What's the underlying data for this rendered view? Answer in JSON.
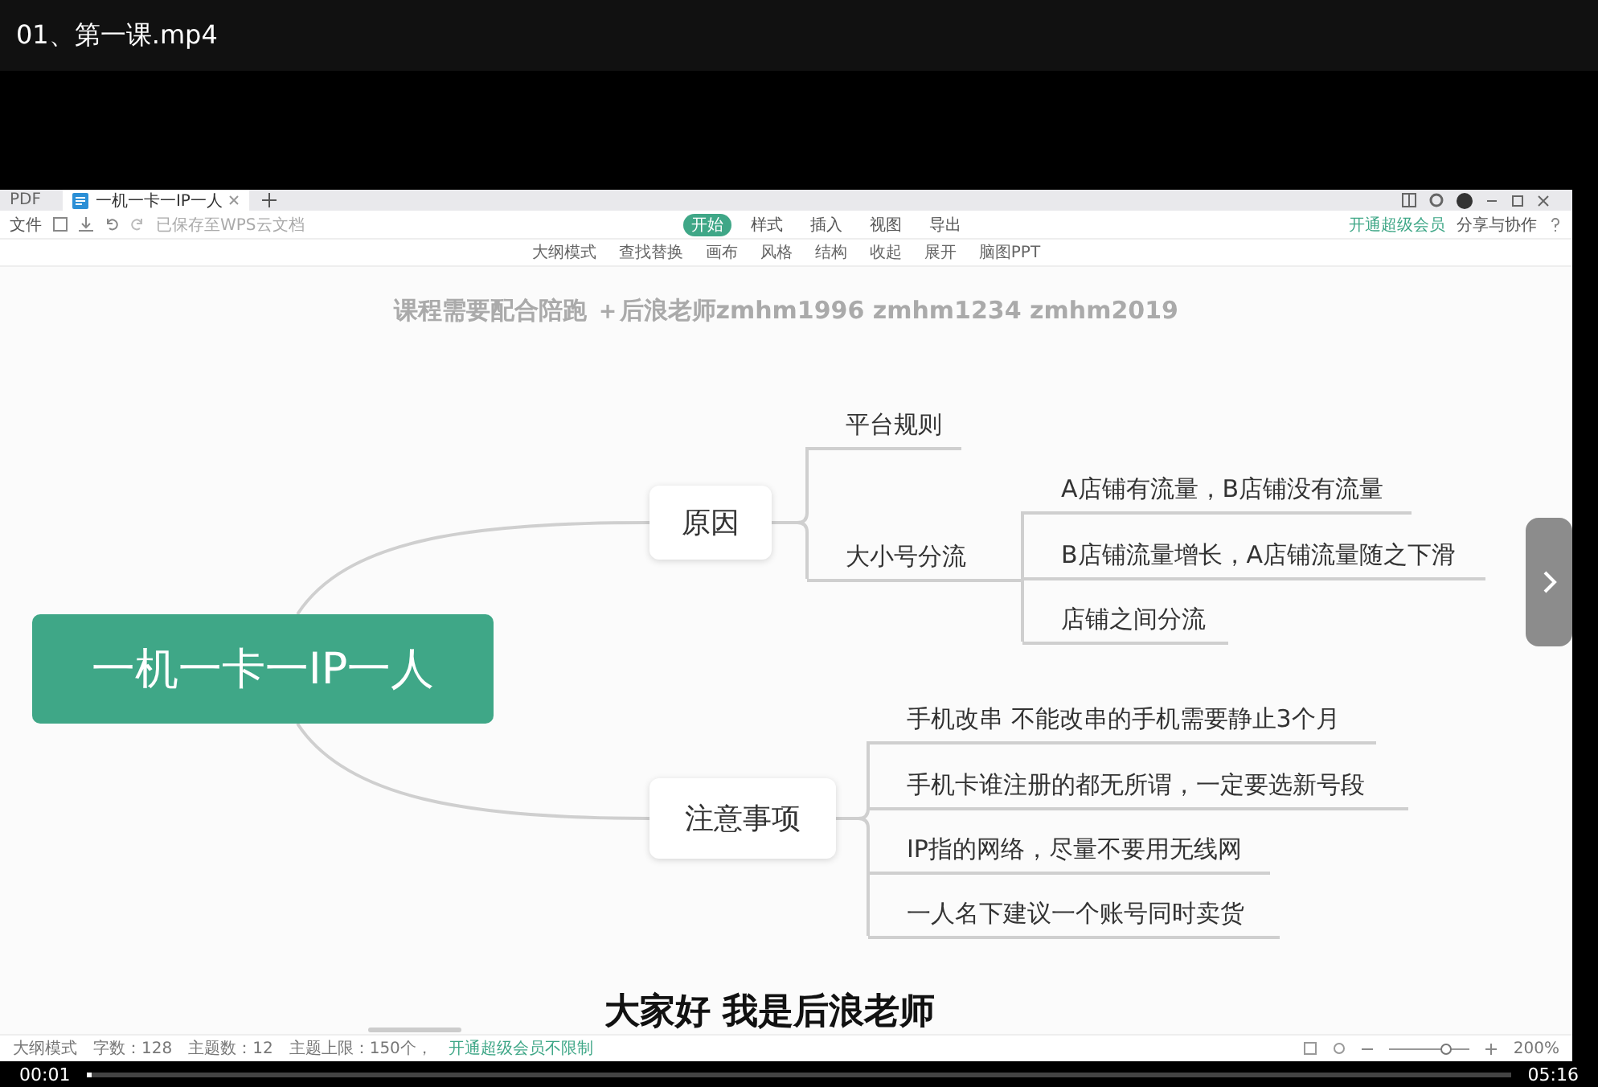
{
  "player": {
    "title": "01、第一课.mp4",
    "current_time": "00:01",
    "duration": "05:16",
    "progress": {
      "level": 0.004
    }
  },
  "app": {
    "tabs": [
      {
        "label": "PDF",
        "selected": false
      },
      {
        "label": "一机一卡一IP一人",
        "selected": true
      }
    ],
    "file_menu": "文件",
    "save_status": "已保存至WPS云文档",
    "menu": [
      {
        "label": "开始",
        "selected": true
      },
      {
        "label": "样式",
        "selected": false
      },
      {
        "label": "插入",
        "selected": false
      },
      {
        "label": "视图",
        "selected": false
      },
      {
        "label": "导出",
        "selected": false
      }
    ],
    "vip_link": "开通超级会员",
    "share_button": "分享与协作",
    "toolbar": [
      "大纲模式",
      "查找替换",
      "画布",
      "风格",
      "结构",
      "收起",
      "展开",
      "脑图PPT"
    ]
  },
  "caption": "课程需要配合陪跑 ＋后浪老师zmhm1996 zmhm1234 zmhm2019",
  "mindmap": {
    "label": "一机一卡一IP一人",
    "children": [
      {
        "label": "原因",
        "children": [
          {
            "label": "平台规则"
          },
          {
            "label": "大小号分流",
            "children": [
              {
                "label": "A店铺有流量，B店铺没有流量"
              },
              {
                "label": "B店铺流量增长，A店铺流量随之下滑"
              },
              {
                "label": "店铺之间分流"
              }
            ]
          }
        ]
      },
      {
        "label": "注意事项",
        "children": [
          {
            "label": "手机改串 不能改串的手机需要静止3个月"
          },
          {
            "label": "手机卡谁注册的都无所谓，一定要选新号段"
          },
          {
            "label": "IP指的网络，尽量不要用无线网"
          },
          {
            "label": "一人名下建议一个账号同时卖货"
          }
        ]
      }
    ]
  },
  "subtitle": "大家好 我是后浪老师",
  "status_bar": {
    "items": [
      "大纲模式",
      "字数：128",
      "主题数：12"
    ],
    "limit": "主题上限：150个，",
    "upgrade_link": "开通超级会员不限制",
    "zoom": {
      "level": 0.7,
      "reading": "200%"
    }
  }
}
